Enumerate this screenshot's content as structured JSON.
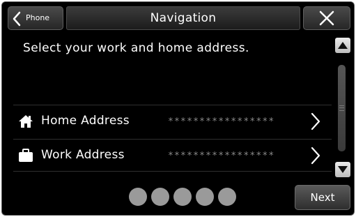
{
  "header": {
    "back_label": "Phone",
    "title": "Navigation"
  },
  "main": {
    "instruction": "Select your work and home address.",
    "rows": [
      {
        "label": "Home Address",
        "masked_value": "*****************"
      },
      {
        "label": "Work Address",
        "masked_value": "*****************"
      }
    ]
  },
  "footer": {
    "page_dots": 5,
    "next_label": "Next"
  },
  "icons": {
    "back": "chevron-left-icon",
    "close": "close-icon",
    "home": "house-icon",
    "work": "briefcase-icon",
    "row_action": "chevron-right-icon",
    "scroll_up": "arrow-up-icon",
    "scroll_down": "arrow-down-icon"
  },
  "colors": {
    "background": "#000000",
    "text": "#ffffff",
    "masked_text": "#8a8a8a",
    "dot": "#9a9a9a"
  }
}
